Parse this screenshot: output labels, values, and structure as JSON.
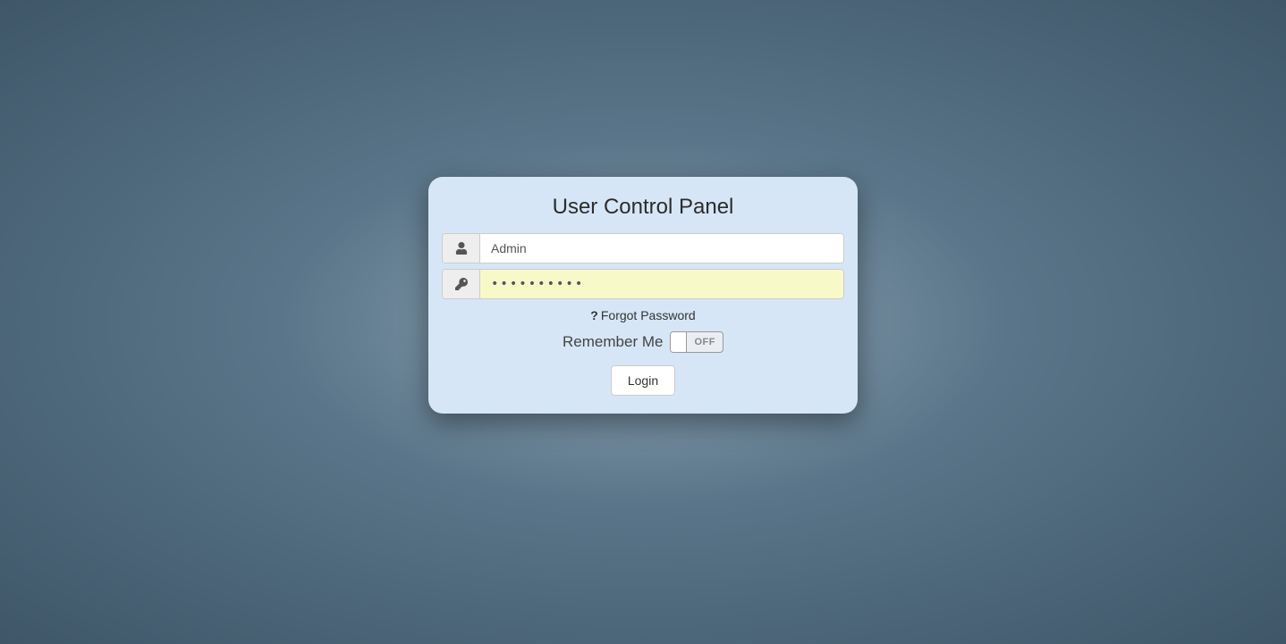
{
  "panel": {
    "title": "User Control Panel",
    "username": {
      "value": "Admin",
      "placeholder": ""
    },
    "password": {
      "value": "••••••••••",
      "placeholder": ""
    },
    "forgot_label": "Forgot Password",
    "remember_label": "Remember Me",
    "toggle_state": "OFF",
    "login_label": "Login"
  }
}
